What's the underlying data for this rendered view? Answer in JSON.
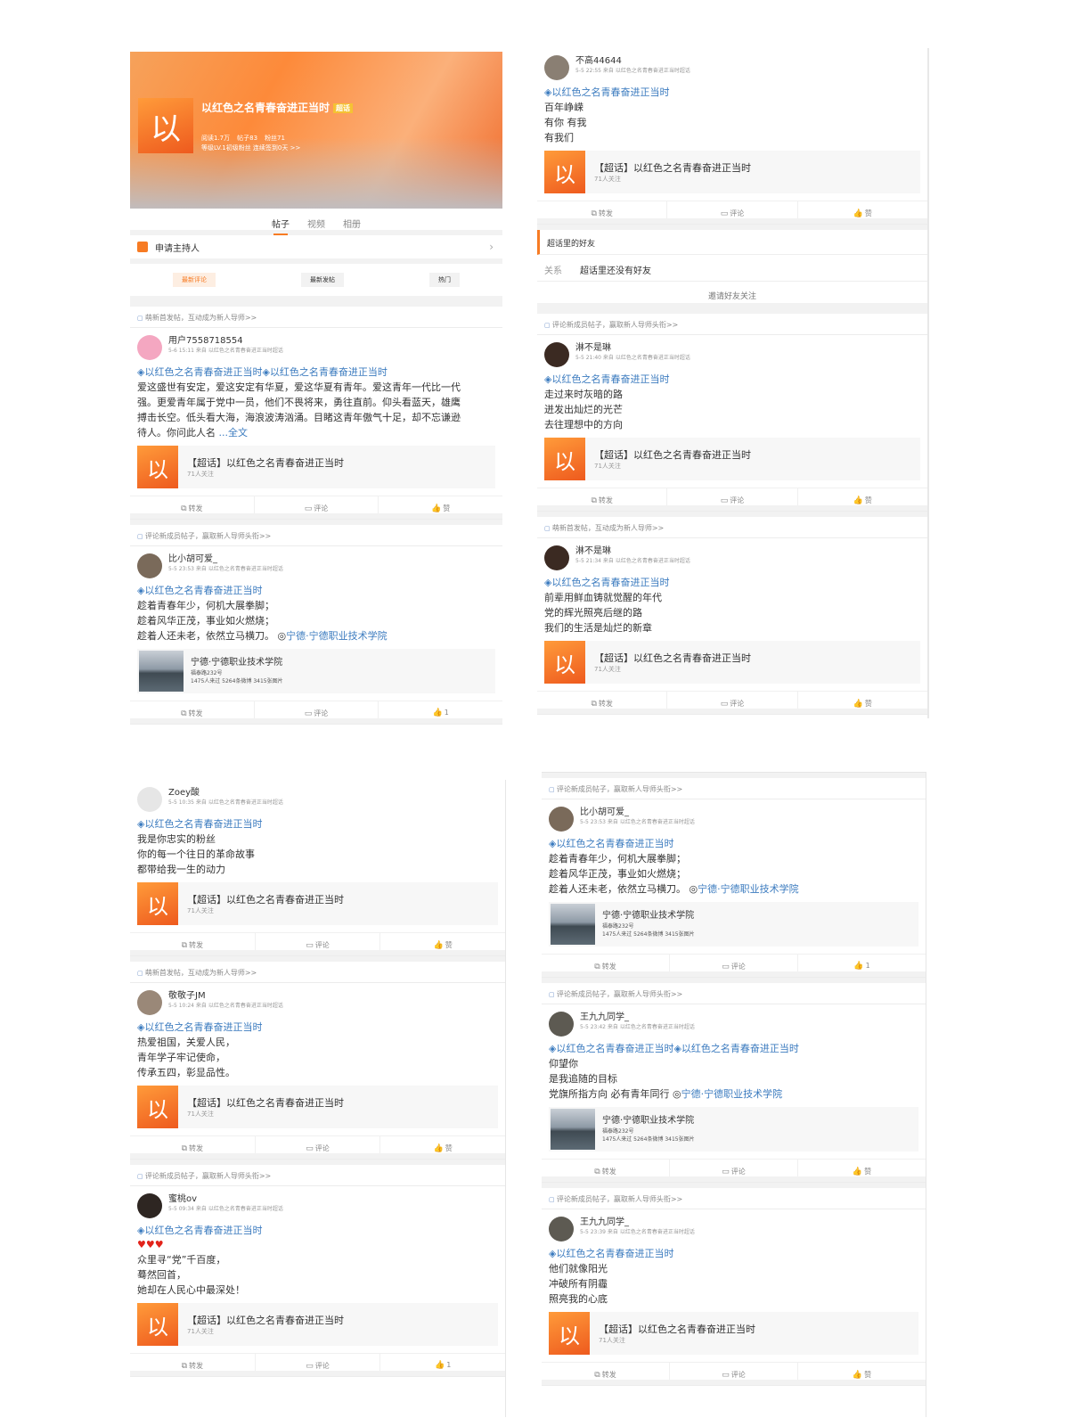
{
  "topic_name": "以红色之名青春奋进正当时",
  "topic_char": "以",
  "header": {
    "title": "以红色之名青春奋进正当时",
    "badge": "超话",
    "stats": [
      "阅读1.7万",
      "帖子83",
      "粉丝71"
    ],
    "sub": "等级LV.1初级粉丝  连续签到0天 >>"
  },
  "tabs": [
    "帖子",
    "视频",
    "相册"
  ],
  "host_label": "申请主持人",
  "sort_buttons": [
    "最新评论",
    "最新发帖",
    "热门"
  ],
  "card": {
    "title": "【超话】以红色之名青春奋进正当时",
    "sub": "71人关注"
  },
  "actions": {
    "repost": "转发",
    "comment": "评论",
    "like": "赞"
  },
  "location_card": {
    "title": "宁德·宁德职业技术学院",
    "addr": "福泰路232号",
    "stats": "1475人来过 5264条微博 3415张图片"
  },
  "friends": {
    "title": "超话里的好友",
    "label": "关系",
    "value": "超话里还没有好友",
    "invite": "邀请好友关注"
  },
  "panels": [
    {
      "posts": [
        {
          "tip": "萌新首发帖，互动成为新人导师>>",
          "user": "用户7558718554",
          "meta": "5-6 15:11 来自 以红色之名青春奋进正当时超话",
          "topics": [
            "以红色之名青春奋进正当时",
            "以红色之名青春奋进正当时"
          ],
          "lines": [
            "爱这盛世有安定，爱这安定有华夏，爱这华夏有青年。爱这青年一代比一代",
            "强。更爱青年属于党中一员，他们不畏将来，勇往直前。仰头看蓝天，雄鹰",
            "搏击长空。低头看大海，海浪波涛汹涌。目睹这青年傲气十足，却不忘谦逊",
            "待人。你问此人名"
          ],
          "more": "...全文",
          "card": "topic",
          "like": "赞",
          "avatar": "#f4a7c1"
        },
        {
          "tip": "评论新成员帖子，赢取新人导师头衔>>",
          "user": "比小胡可爱_",
          "meta": "5-5 23:53 来自 以红色之名青春奋进正当时超话",
          "topics": [
            "以红色之名青春奋进正当时"
          ],
          "lines": [
            "趁着青春年少，何机大展拳脚；",
            "趁着风华正茂，事业如火燃烧；",
            "趁着人还未老，依然立马横刀。"
          ],
          "loc": "宁德·宁德职业技术学院",
          "card": "location",
          "like": "1",
          "avatar": "#7a6a5a"
        }
      ]
    },
    {
      "posts": [
        {
          "user": "不高44644",
          "meta": "5-5 22:55 来自 以红色之名青春奋进正当时超话",
          "topics": [
            "以红色之名青春奋进正当时"
          ],
          "lines": [
            "百年峥嵘",
            "有你 有我",
            "有我们"
          ],
          "card": "topic",
          "like": "赞",
          "avatar": "#8a7f73"
        },
        {
          "tip": "评论新成员帖子，赢取新人导师头衔>>",
          "user": "淋不是琳",
          "meta": "5-5 21:40 来自 以红色之名青春奋进正当时超话",
          "topics": [
            "以红色之名青春奋进正当时"
          ],
          "lines": [
            "走过来时灰暗的路",
            "迸发出灿烂的光芒",
            "去往理想中的方向"
          ],
          "card": "topic",
          "like": "赞",
          "avatar": "#3b2a22"
        },
        {
          "tip": "萌新首发帖，互动成为新人导师>>",
          "user": "淋不是琳",
          "meta": "5-5 21:34 来自 以红色之名青春奋进正当时超话",
          "topics": [
            "以红色之名青春奋进正当时"
          ],
          "lines": [
            "前辈用鲜血铸就觉醒的年代",
            "党的辉光照亮后继的路",
            "我们的生活是灿烂的新章"
          ],
          "card": "topic",
          "like": "赞",
          "avatar": "#3b2a22"
        }
      ]
    },
    {
      "posts": [
        {
          "user": "Zoey酸",
          "meta": "5-5 10:35 来自 以红色之名青春奋进正当时超话",
          "topics": [
            "以红色之名青春奋进正当时"
          ],
          "lines": [
            "我是你忠实的粉丝",
            "你的每一个往日的革命故事",
            "都带给我一生的动力"
          ],
          "card": "topic",
          "like": "赞",
          "avatar": "#e6e6e6"
        },
        {
          "tip": "萌新首发帖，互动成为新人导师>>",
          "user": "敬敬子JM",
          "meta": "5-5 10:24 来自 以红色之名青春奋进正当时超话",
          "topics": [
            "以红色之名青春奋进正当时"
          ],
          "lines": [
            "热爱祖国，关爱人民，",
            "青年学子牢记使命，",
            "传承五四，彰显品性。"
          ],
          "card": "topic",
          "like": "赞",
          "avatar": "#9a8878"
        },
        {
          "tip": "评论新成员帖子，赢取新人导师头衔>>",
          "user": "蜜桃ov",
          "meta": "5-5 09:34 来自 以红色之名青春奋进正当时超话",
          "topics": [
            "以红色之名青春奋进正当时"
          ],
          "hearts": "♥♥♥",
          "lines": [
            "众里寻“党”千百度，",
            "蓦然回首，",
            "她却在人民心中最深处！"
          ],
          "card": "topic",
          "like": "1",
          "avatar": "#2e2622"
        }
      ]
    },
    {
      "posts": [
        {
          "tip": "评论新成员帖子，赢取新人导师头衔>>",
          "user": "比小胡可爱_",
          "meta": "5-5 23:53 来自 以红色之名青春奋进正当时超话",
          "topics": [
            "以红色之名青春奋进正当时"
          ],
          "lines": [
            "趁着青春年少，何机大展拳脚；",
            "趁着风华正茂，事业如火燃烧；",
            "趁着人还未老，依然立马横刀。"
          ],
          "loc": "宁德·宁德职业技术学院",
          "card": "location",
          "like": "1",
          "avatar": "#7a6a5a"
        },
        {
          "tip": "评论新成员帖子，赢取新人导师头衔>>",
          "user": "王九九同学_",
          "meta": "5-5 23:42 来自 以红色之名青春奋进正当时超话",
          "topics": [
            "以红色之名青春奋进正当时",
            "以红色之名青春奋进正当时"
          ],
          "lines": [
            "仰望你",
            "是我追随的目标",
            "党旗所指方向 必有青年同行"
          ],
          "loc": "宁德·宁德职业技术学院",
          "card": "location",
          "like": "赞",
          "avatar": "#5d5a52"
        },
        {
          "tip": "评论新成员帖子，赢取新人导师头衔>>",
          "user": "王九九同学_",
          "meta": "5-5 23:39 来自 以红色之名青春奋进正当时超话",
          "topics": [
            "以红色之名青春奋进正当时"
          ],
          "lines": [
            "他们就像阳光",
            "冲破所有阴霾",
            "照亮我的心底"
          ],
          "card": "topic",
          "like": "赞",
          "avatar": "#5d5a52"
        }
      ]
    }
  ]
}
